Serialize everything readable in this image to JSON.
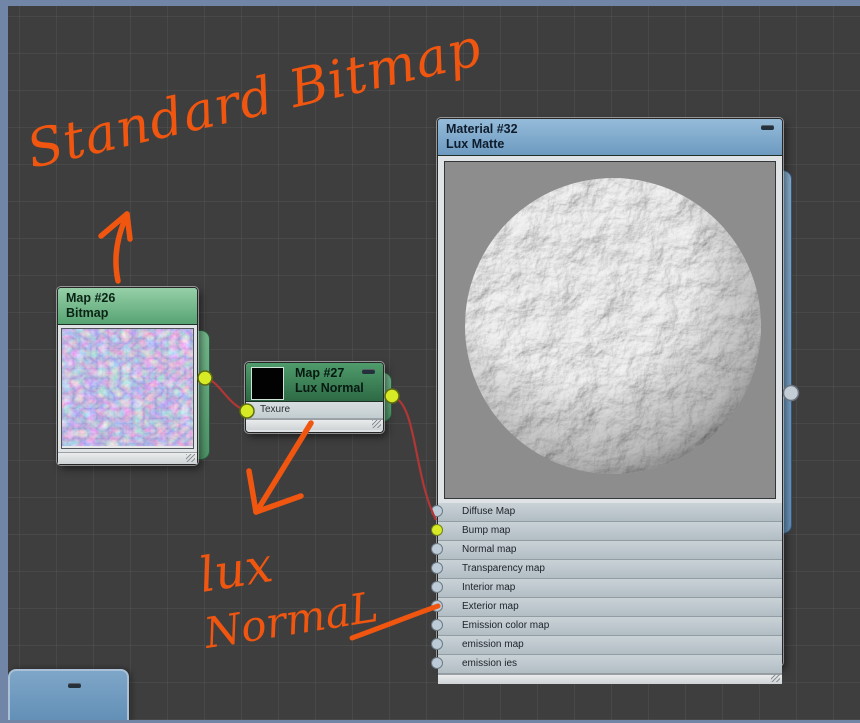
{
  "canvas": {
    "background": "#3e3e3e",
    "grid_line": "rgba(255,255,255,0.05)",
    "frame_color": "#7186a6",
    "wire_color": "#b23636",
    "socket_color": "#d6ea25",
    "ink_color": "#f0560f"
  },
  "annotations": {
    "standard_bitmap": "Standard Bitmap",
    "lux_line1": "lux",
    "lux_line2": "NormaL"
  },
  "nodes": {
    "map26": {
      "title": "Map #26",
      "subtitle": "Bitmap"
    },
    "map27": {
      "title": "Map #27",
      "subtitle": "Lux Normal",
      "slot": "Texure"
    },
    "material": {
      "title": "Material #32",
      "subtitle": "Lux Matte",
      "slots": [
        "Diffuse Map",
        "Bump map",
        "Normal map",
        "Transparency map",
        "Interior map",
        "Exterior map",
        "Emission color map",
        "emission map",
        "emission ies"
      ],
      "connected_slot": "Bump map"
    }
  }
}
